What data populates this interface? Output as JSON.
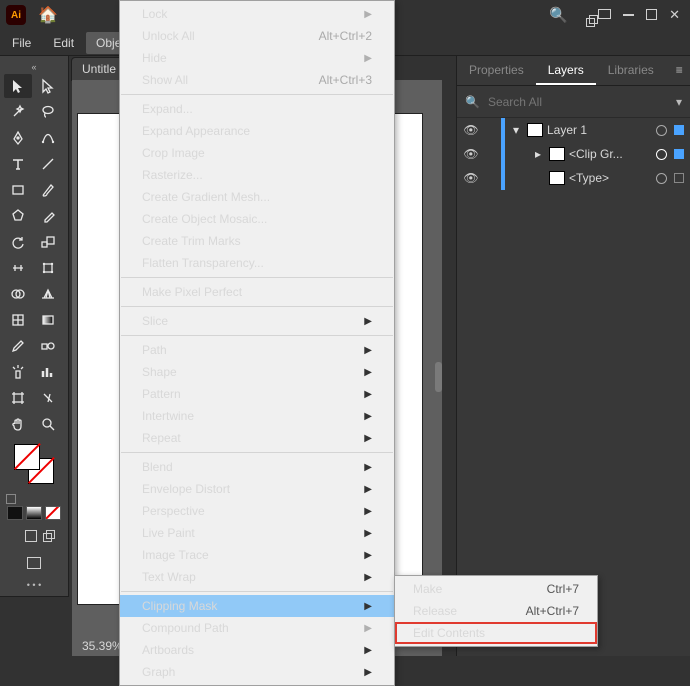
{
  "app": {
    "badge": "Ai"
  },
  "menubar": [
    "File",
    "Edit",
    "Object"
  ],
  "doc_tab": "Untitle",
  "status_zoom": "35.39%",
  "panels": {
    "tabs": [
      "Properties",
      "Layers",
      "Libraries"
    ],
    "search_placeholder": "Search All",
    "layers": [
      {
        "name": "Layer 1",
        "expanded": true,
        "selected": false
      },
      {
        "name": "<Clip Gr...",
        "expanded": false,
        "selected": true
      },
      {
        "name": "<Type>",
        "expanded": false,
        "selected": false
      }
    ]
  },
  "tools": {
    "row0": [
      "selection",
      "direct-selection"
    ],
    "row1": [
      "magic-wand",
      "lasso"
    ],
    "row2": [
      "pen",
      "curvature"
    ],
    "row3": [
      "type",
      "line-segment"
    ],
    "row4": [
      "rectangle",
      "paintbrush"
    ],
    "row5": [
      "shaper",
      "eraser"
    ],
    "row6": [
      "rotate",
      "scale"
    ],
    "row7": [
      "width",
      "free-transform"
    ],
    "row8": [
      "shape-builder",
      "perspective-grid"
    ],
    "row9": [
      "mesh",
      "gradient"
    ],
    "row10": [
      "eyedropper",
      "blend"
    ],
    "row11": [
      "symbol-sprayer",
      "column-graph"
    ],
    "row12": [
      "artboard",
      "slice"
    ],
    "row13": [
      "hand",
      "zoom"
    ]
  },
  "menu": {
    "items": [
      {
        "label": "Lock",
        "disabled": true,
        "submenu": true
      },
      {
        "label": "Unlock All",
        "shortcut": "Alt+Ctrl+2",
        "disabled": true
      },
      {
        "label": "Hide",
        "disabled": true,
        "submenu": true
      },
      {
        "label": "Show All",
        "shortcut": "Alt+Ctrl+3",
        "disabled": true
      },
      {
        "sep": true
      },
      {
        "label": "Expand..."
      },
      {
        "label": "Expand Appearance",
        "disabled": true
      },
      {
        "label": "Crop Image",
        "disabled": true
      },
      {
        "label": "Rasterize..."
      },
      {
        "label": "Create Gradient Mesh..."
      },
      {
        "label": "Create Object Mosaic...",
        "disabled": true
      },
      {
        "label": "Create Trim Marks"
      },
      {
        "label": "Flatten Transparency..."
      },
      {
        "sep": true
      },
      {
        "label": "Make Pixel Perfect"
      },
      {
        "sep": true
      },
      {
        "label": "Slice",
        "submenu": true
      },
      {
        "sep": true
      },
      {
        "label": "Path",
        "submenu": true
      },
      {
        "label": "Shape",
        "submenu": true
      },
      {
        "label": "Pattern",
        "submenu": true
      },
      {
        "label": "Intertwine",
        "submenu": true
      },
      {
        "label": "Repeat",
        "submenu": true
      },
      {
        "sep": true
      },
      {
        "label": "Blend",
        "submenu": true
      },
      {
        "label": "Envelope Distort",
        "submenu": true
      },
      {
        "label": "Perspective",
        "submenu": true
      },
      {
        "label": "Live Paint",
        "submenu": true
      },
      {
        "label": "Image Trace",
        "submenu": true
      },
      {
        "label": "Text Wrap",
        "submenu": true
      },
      {
        "sep": true
      },
      {
        "label": "Clipping Mask",
        "submenu": true,
        "hl": true
      },
      {
        "label": "Compound Path",
        "disabled": true,
        "submenu": true
      },
      {
        "label": "Artboards",
        "submenu": true
      },
      {
        "label": "Graph",
        "submenu": true
      }
    ]
  },
  "submenu": {
    "items": [
      {
        "label": "Make",
        "shortcut": "Ctrl+7"
      },
      {
        "label": "Release",
        "shortcut": "Alt+Ctrl+7"
      },
      {
        "label": "Edit Contents",
        "boxed": true
      }
    ]
  }
}
